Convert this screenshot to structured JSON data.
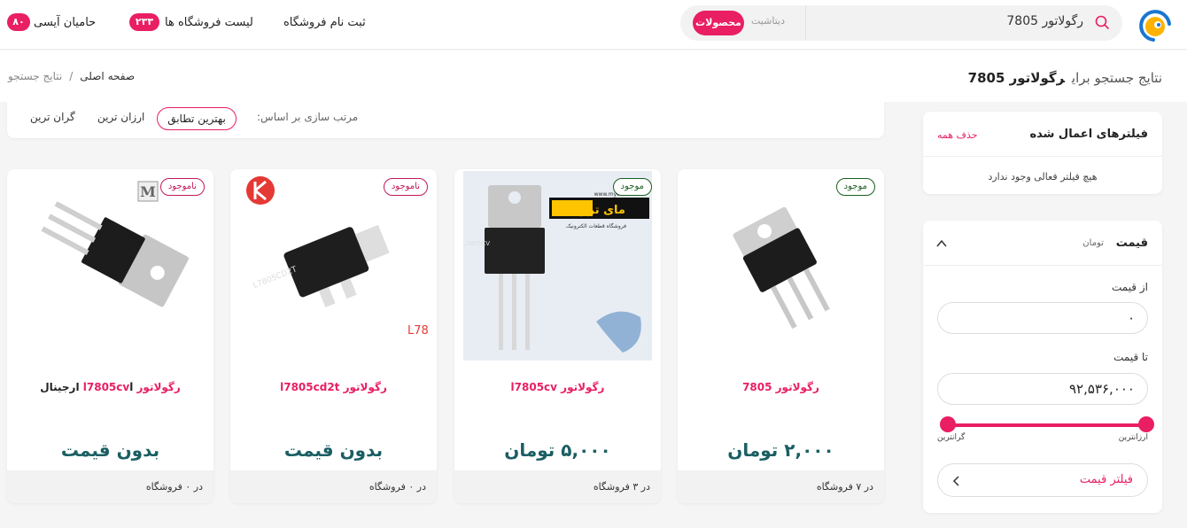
{
  "header": {
    "search": {
      "query": "رگولاتور 7805",
      "tab_products": "محصولات",
      "tab_datasheet": "دیتاشیت"
    },
    "nav": {
      "register_store": "ثبت نام فروشگاه",
      "stores_list": "لیست فروشگاه ها",
      "stores_count": "۲۳۳",
      "sponsors": "حامیان آیسی",
      "sponsors_count": "۸۰"
    }
  },
  "titlebar": {
    "results_prefix": "نتایج جستجو برای",
    "results_query": "رگولاتور 7805",
    "breadcrumb": {
      "home": "صفحه اصلی",
      "sep": "/",
      "current": "نتایج جستجو"
    }
  },
  "sort": {
    "label": "مرتب سازی بر اساس:",
    "options": [
      "بهترین تطابق",
      "ارزان ترین",
      "گران ترین"
    ],
    "active": "بهترین تطابق"
  },
  "products": [
    {
      "stock": "موجود",
      "in_stock": true,
      "title_pink": "رگولاتور 7805",
      "title_rest": "",
      "price": "۲,۰۰۰ تومان",
      "stores": "در ۷ فروشگاه"
    },
    {
      "stock": "موجود",
      "in_stock": true,
      "title_pink": "رگولاتور l7805cv",
      "title_rest": "",
      "price": "۵,۰۰۰ تومان",
      "stores": "در ۳ فروشگاه",
      "image_text": {
        "brand": "مای ترونیک",
        "tagline": "فروشگاه قطعات الکترونیک",
        "url": "www.mytronic.ir",
        "chip": "L7805CV"
      }
    },
    {
      "stock": "ناموجود",
      "in_stock": false,
      "title_pink": "رگولاتور l7805cd2t",
      "title_rest": "",
      "price": "بدون قیمت",
      "stores": "در ۰ فروشگاه",
      "image_text": {
        "caption": "L7805CD2T",
        "chip": "L7805CD2T"
      }
    },
    {
      "stock": "ناموجود",
      "in_stock": false,
      "title_pink": "رگولاتور l7805cv",
      "title_rest": "l ارجینال",
      "price": "بدون قیمت",
      "stores": "در ۰ فروشگاه",
      "image_text": {
        "logo": "M"
      }
    }
  ],
  "filters": {
    "applied_title": "فیلترهای اعمال شده",
    "clear_all": "حذف همه",
    "empty": "هیچ فیلتر فعالی وجود ندارد",
    "price_title": "قیمت",
    "price_unit": "تومان",
    "from_label": "از قیمت",
    "from_value": "۰",
    "to_label": "تا قیمت",
    "to_value": "۹۲,۵۳۶,۰۰۰",
    "cheapest": "ارزانترین",
    "most_expensive": "گرانترین",
    "apply_button": "فیلتر قیمت",
    "range_min_fraction": 0,
    "range_max_fraction": 1
  },
  "colors": {
    "accent": "#e91e63",
    "price": "#1a5e63",
    "in_stock": "#1b5e20"
  }
}
